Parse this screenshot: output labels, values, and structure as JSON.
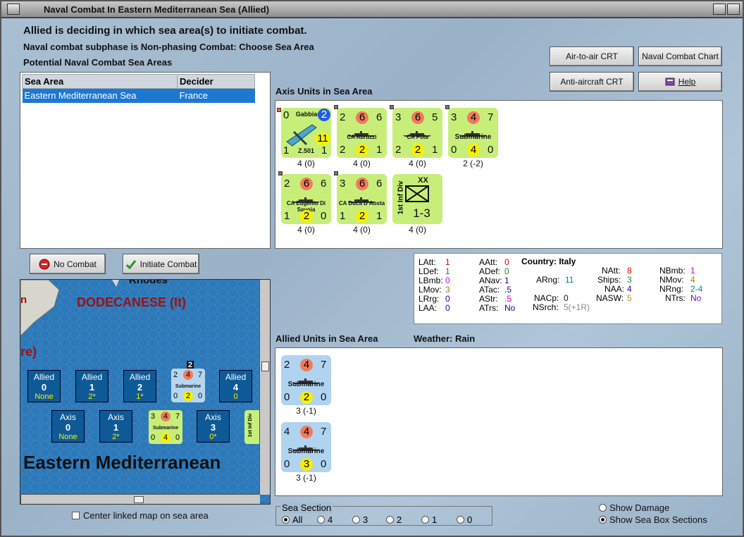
{
  "window": {
    "title": "Naval Combat In Eastern Mediterranean Sea (Allied)"
  },
  "header": {
    "line1": "Allied is deciding in which sea area(s) to initiate combat.",
    "line2": "Naval combat subphase is Non-phasing Combat: Choose Sea Area",
    "line3": "Potential Naval Combat Sea Areas"
  },
  "sea_table": {
    "col1": "Sea Area",
    "col2": "Decider",
    "row": {
      "area": "Eastern Mediterranean Sea",
      "decider": "France"
    }
  },
  "buttons": {
    "air_crt": "Air-to-air CRT",
    "naval_chart": "Naval Combat Chart",
    "aa_crt": "Anti-aircraft CRT",
    "help": "Help",
    "no_combat": "No Combat",
    "initiate": "Initiate Combat"
  },
  "axis_title": "Axis Units in Sea Area",
  "axis_units": [
    {
      "tl": "0",
      "name": "Gabbiano",
      "badge": "2",
      "yel": "11",
      "b1": "1",
      "b2": "Z.501",
      "b3": "1",
      "under": "4 (0)"
    },
    {
      "tl": "2",
      "red": "6",
      "tr": "6",
      "name": "CA Abruzzi",
      "bl": "2",
      "yel": "2",
      "br": "1",
      "under": "4 (0)"
    },
    {
      "tl": "3",
      "red": "6",
      "tr": "5",
      "name": "CA Pola",
      "bl": "2",
      "yel": "2",
      "br": "1",
      "under": "4 (0)"
    },
    {
      "tl": "3",
      "red": "4",
      "tr": "7",
      "name": "Submarine",
      "bl": "0",
      "yel": "4",
      "br": "0",
      "under": "2 (-2)"
    },
    {
      "tl": "2",
      "red": "6",
      "tr": "6",
      "name": "CA Eugenio Di Savoia",
      "bl": "1",
      "yel": "2",
      "br": "0",
      "under": "4 (0)"
    },
    {
      "tl": "3",
      "red": "6",
      "tr": "6",
      "name": "CA Duca D'Aosta",
      "bl": "1",
      "yel": "2",
      "br": "1",
      "under": "4 (0)"
    },
    {
      "top": "XX",
      "side": "1st Inf Div",
      "val": "1-3",
      "under": "4 (0)"
    }
  ],
  "stats": {
    "latt": "LAtt:",
    "latt_v": "1",
    "ldef": "LDef:",
    "ldef_v": "1",
    "lbmb": "LBmb:",
    "lbmb_v": "0",
    "lmov": "LMov:",
    "lmov_v": "3",
    "lrg": "LRrg:",
    "lrg_v": "0",
    "laa": "LAA:",
    "laa_v": "0",
    "aatt": "AAtt:",
    "aatt_v": "0",
    "adef": "ADef:",
    "adef_v": "0",
    "anav": "ANav:",
    "anav_v": "1",
    "atac": "ATac:",
    "atac_v": ".5",
    "astr": "AStr:",
    "astr_v": ".5",
    "atrs": "ATrs:",
    "atrs_v": "No",
    "country": "Country: Italy",
    "arng": "ARng:",
    "arng_v": "11",
    "nacp": "NACp:",
    "nacp_v": "0",
    "nsrch": "NSrch:",
    "nsrch_v": "5(+1R)",
    "natt": "NAtt:",
    "natt_v": "8",
    "ships": "Ships:",
    "ships_v": "3",
    "naa": "NAA:",
    "naa_v": "4",
    "nasw": "NASW:",
    "nasw_v": "5",
    "nbmb": "NBmb:",
    "nbmb_v": "1",
    "nmov": "NMov:",
    "nmov_v": "4",
    "nrng": "NRng:",
    "nrng_v": "2-4",
    "ntrs": "NTrs:",
    "ntrs_v": "No"
  },
  "allied_title": "Allied Units in Sea Area",
  "weather": "Weather:  Rain",
  "allied_units": [
    {
      "tl": "2",
      "red": "4",
      "tr": "7",
      "name": "Submarine",
      "bl": "0",
      "yel": "2",
      "br": "0",
      "under": "3 (-1)"
    },
    {
      "tl": "4",
      "red": "4",
      "tr": "7",
      "name": "Submarine",
      "bl": "0",
      "yel": "3",
      "br": "0",
      "under": "3 (-1)"
    }
  ],
  "map": {
    "rhodes": "Rhodes",
    "dodecanese": "DODECANESE (It)",
    "n": "n",
    "re": "re)",
    "label": "Eastern Mediterranean",
    "allied_boxes": [
      {
        "t": "Allied",
        "n": "0",
        "v": "None"
      },
      {
        "t": "Allied",
        "n": "1",
        "v": "2*"
      },
      {
        "t": "Allied",
        "n": "2",
        "v": "1*"
      },
      {
        "t": "Allied",
        "n": "4",
        "v": "0"
      }
    ],
    "axis_boxes": [
      {
        "t": "Axis",
        "n": "0",
        "v": "None"
      },
      {
        "t": "Axis",
        "n": "1",
        "v": "2*"
      },
      {
        "t": "Axis",
        "n": "3",
        "v": "0*"
      }
    ],
    "stack_count": "2",
    "mini_allied": {
      "tl": "2",
      "red": "4",
      "tr": "7",
      "name": "Submarine",
      "bl": "0",
      "yel": "2",
      "br": "0"
    },
    "mini_axis": {
      "tl": "3",
      "red": "4",
      "tr": "7",
      "name": "Submarine",
      "bl": "0",
      "yel": "4",
      "br": "0"
    },
    "mini_div": "1st Inf Div"
  },
  "center_linked": "Center linked map on sea area",
  "sea_section": {
    "title": "Sea Section",
    "options": [
      "All",
      "4",
      "3",
      "2",
      "1",
      "0"
    ],
    "selected": "All"
  },
  "show": {
    "damage": "Show Damage",
    "sections": "Show Sea Box Sections"
  }
}
